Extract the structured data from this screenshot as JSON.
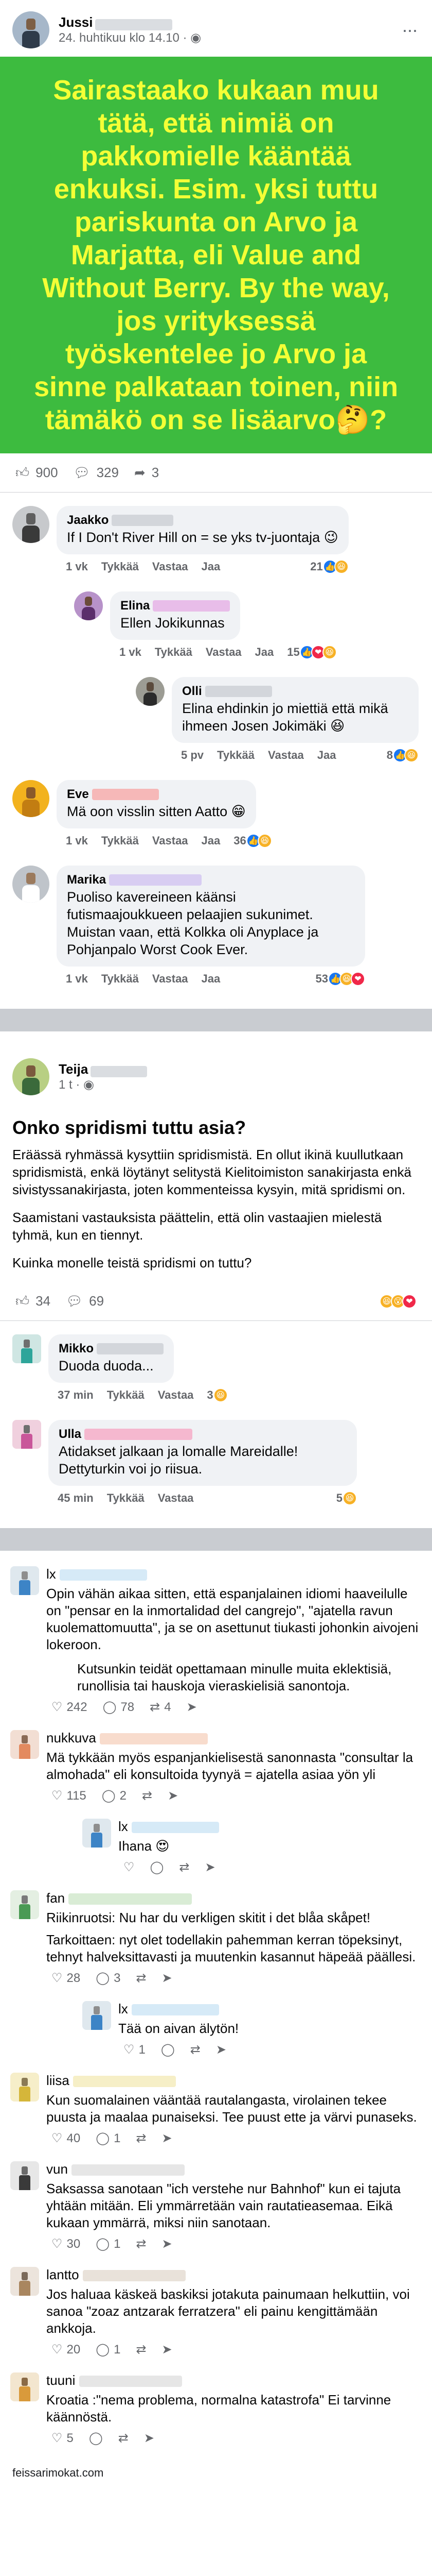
{
  "post1": {
    "author": "Jussi",
    "timestamp": "24. huhtikuu klo 14.10",
    "privacy_icon": "globe-icon",
    "card_text": "Sairastaako kukaan muu tätä, että nimiä on pakkomielle kääntää enkuksi. Esim. yksi tuttu pariskunta on Arvo ja Marjatta, eli Value and Without Berry. By the way, jos yrityksessä työskentelee jo Arvo ja sinne palkataan toinen, niin tämäkö on se lisäarvo🤔?",
    "card_bg": "#3dbb3f",
    "card_fg": "#f4ff36",
    "reactions_count": "900",
    "comments_count": "329",
    "shares_count": "3",
    "comments": [
      {
        "author": "Jaakko",
        "text": "If I Don't River Hill on = se yks tv-juontaja 😉",
        "age": "1 vk",
        "reply": "Tykkää",
        "answer": "Vastaa",
        "translate": "Jaa",
        "count": "21"
      },
      {
        "author": "Elina",
        "text": "Ellen Jokikunnas",
        "age": "1 vk",
        "reply": "Tykkää",
        "answer": "Vastaa",
        "translate": "Jaa",
        "count": "15"
      },
      {
        "author": "Olli",
        "text": "Elina ehdinkin jo miettiä että mikä ihmeen Josen Jokimäki 😆",
        "age": "5 pv",
        "reply": "Tykkää",
        "answer": "Vastaa",
        "translate": "Jaa",
        "count": "8"
      },
      {
        "author": "Eve",
        "text": "Mä oon visslin sitten Aatto 😁",
        "age": "1 vk",
        "reply": "Tykkää",
        "answer": "Vastaa",
        "translate": "Jaa",
        "count": "36"
      },
      {
        "author": "Marika",
        "text": "Puoliso kavereineen käänsi futismaajoukkueen pelaajien sukunimet. Muistan vaan, että Kolkka oli Anyplace ja Pohjanpalo Worst Cook Ever.",
        "age": "1 vk",
        "reply": "Tykkää",
        "answer": "Vastaa",
        "translate": "Jaa",
        "count": "53"
      }
    ]
  },
  "post2": {
    "author": "Teija",
    "timestamp": "1 t",
    "title": "Onko spridismi tuttu asia?",
    "paragraphs": [
      "Eräässä ryhmässä kysyttiin spridismistä. En ollut ikinä kuullutkaan spridismistä, enkä löytänyt selitystä Kielitoimiston sanakirjasta enkä sivistyssanakirjasta, joten kommenteissa kysyin, mitä spridismi on.",
      "Saamistani vastauksista päättelin, että olin vastaajien mielestä tyhmä, kun en tiennyt.",
      "Kuinka monelle teistä spridismi on tuttu?"
    ],
    "reactions_count": "34",
    "comments_count": "69",
    "comments": [
      {
        "author": "Mikko",
        "text": "Duoda duoda...",
        "age": "37 min",
        "reply": "Tykkää",
        "answer": "Vastaa",
        "count": "3"
      },
      {
        "author": "Ulla",
        "text": "Atidakset jalkaan ja lomalle Mareidalle! Dettyturkin voi jo riisua.",
        "age": "45 min",
        "reply": "Tykkää",
        "answer": "Vastaa",
        "count": "5"
      }
    ]
  },
  "thread": {
    "items": [
      {
        "author": "lx",
        "paragraphs": [
          "Opin vähän aikaa sitten, että espanjalainen idiomi haaveilulle on \"pensar en la inmortalidad del cangrejo\", \"ajatella ravun kuolemattomuutta\", ja se on asettunut tiukasti johonkin aivojeni lokeroon.",
          "Kutsunkin teidät opettamaan minulle muita eklektisiä, runollisia tai hauskoja vieraskielisiä sanontoja."
        ],
        "likes": "242",
        "replies": "78",
        "shares": "4"
      },
      {
        "author": "nukkuva",
        "paragraphs": [
          "Mä tykkään myös espanjankielisestä sanonnasta \"consultar la almohada\" eli konsultoida tyynyä = ajatella asiaa yön yli"
        ],
        "likes": "115",
        "replies": "2",
        "shares": ""
      },
      {
        "author": "lx",
        "paragraphs": [
          "Ihana 😍"
        ],
        "likes": "",
        "replies": "",
        "shares": ""
      },
      {
        "author": "fan",
        "paragraphs": [
          "Riikinruotsi: Nu har du verkligen skitit i det blåa skåpet!",
          "Tarkoittaen: nyt olet todellakin pahemman kerran töpeksinyt, tehnyt halveksittavasti ja muutenkin kasannut häpeää päällesi."
        ],
        "likes": "28",
        "replies": "3",
        "shares": ""
      },
      {
        "author": "lx",
        "paragraphs": [
          "Tää on aivan älytön!"
        ],
        "likes": "1",
        "replies": "",
        "shares": ""
      },
      {
        "author": "liisa",
        "paragraphs": [
          "Kun suomalainen vääntää rautalangasta, virolainen tekee puusta ja maalaa punaiseksi. Tee puust ette ja värvi punaseks."
        ],
        "likes": "40",
        "replies": "1",
        "shares": ""
      },
      {
        "author": "vun",
        "paragraphs": [
          "Saksassa sanotaan \"ich verstehe nur Bahnhof\" kun ei tajuta yhtään mitään. Eli ymmärretään vain rautatieasemaa. Eikä kukaan ymmärrä, miksi niin sanotaan."
        ],
        "likes": "30",
        "replies": "1",
        "shares": ""
      },
      {
        "author": "lantto",
        "paragraphs": [
          "Jos haluaa käskeä baskiksi jotakuta painumaan helkuttiin, voi sanoa \"zoaz antzarak ferratzera\" eli painu kengittämään ankkoja."
        ],
        "likes": "20",
        "replies": "1",
        "shares": ""
      },
      {
        "author": "tuuni",
        "paragraphs": [
          "Kroatia :\"nema problema, normalna katastrofa\" Ei tarvinne käännöstä."
        ],
        "likes": "5",
        "replies": "",
        "shares": ""
      }
    ]
  },
  "footer": {
    "watermark": "feissarimokat.com"
  }
}
